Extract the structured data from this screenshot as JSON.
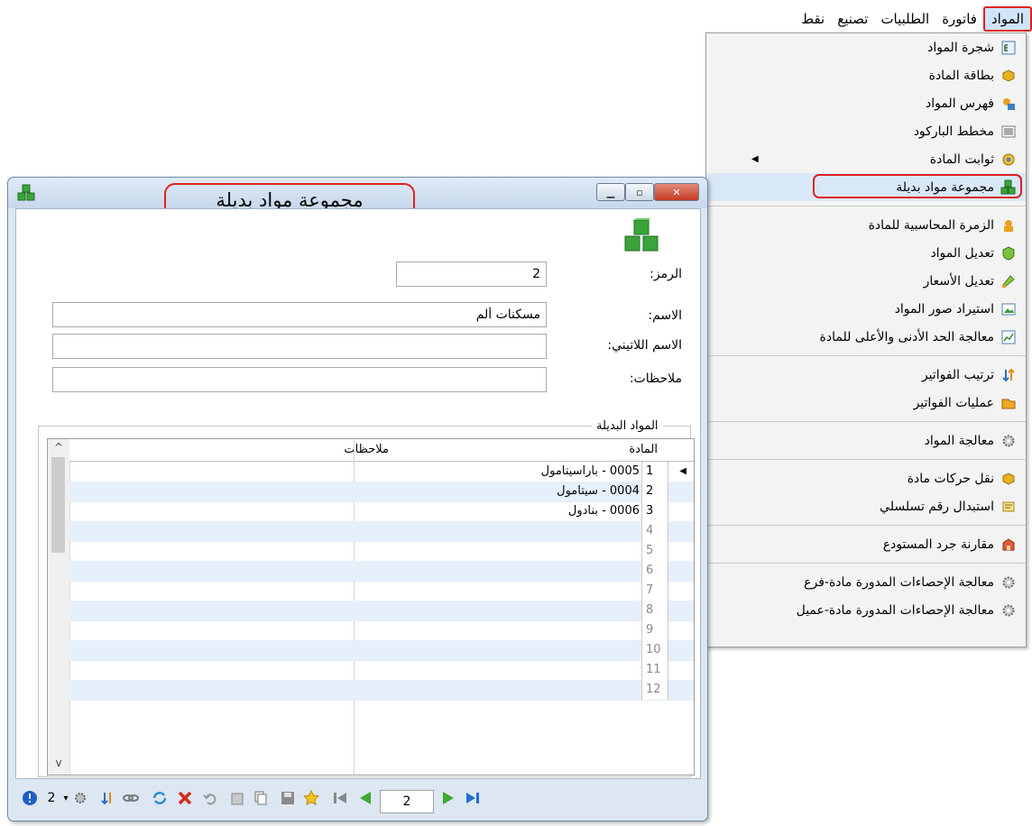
{
  "menubar": {
    "items": [
      {
        "label": "المواد",
        "active": true
      },
      {
        "label": "فاتورة",
        "active": false
      },
      {
        "label": "الطلبيات",
        "active": false
      },
      {
        "label": "تصنيع",
        "active": false
      },
      {
        "label": "نقط",
        "active": false
      }
    ]
  },
  "menu": {
    "items": [
      {
        "label": "شجرة المواد",
        "icon": "tree-icon"
      },
      {
        "label": "بطاقة المادة",
        "icon": "card-icon"
      },
      {
        "label": "فهرس المواد",
        "icon": "index-icon"
      },
      {
        "label": "مخطط الباركود",
        "icon": "barcode-icon"
      },
      {
        "label": "ثوابت المادة",
        "icon": "constants-icon"
      },
      {
        "label": "مجموعة مواد بديلة",
        "icon": "group-icon"
      },
      {
        "label": "الزمرة المحاسبية للمادة",
        "icon": "accounting-icon"
      },
      {
        "label": "تعديل المواد",
        "icon": "edit-materials-icon"
      },
      {
        "label": "تعديل الأسعار",
        "icon": "prices-icon"
      },
      {
        "label": "استيراد صور المواد",
        "icon": "import-images-icon"
      },
      {
        "label": "معالجة الحد الأدنى والأعلى للمادة",
        "icon": "minmax-icon"
      },
      {
        "label": "ترتيب الفواتير",
        "icon": "sort-icon"
      },
      {
        "label": "عمليات الفواتير",
        "icon": "operations-icon"
      },
      {
        "label": "معالجة المواد",
        "icon": "gear-icon"
      },
      {
        "label": "نقل حركات مادة",
        "icon": "transfer-icon"
      },
      {
        "label": "استبدال رقم تسلسلي",
        "icon": "serial-icon"
      },
      {
        "label": "مقارنة جرد المستودع",
        "icon": "warehouse-icon"
      },
      {
        "label": "معالجة الإحصاءات المدورة مادة-فرع",
        "icon": "gear-icon"
      },
      {
        "label": "معالجة الإحصاءات المدورة مادة-عميل",
        "icon": "gear-icon"
      }
    ]
  },
  "window": {
    "title": "مجموعة مواد بديلة",
    "code_label": "الرمز:",
    "code_value": "2",
    "name_label": "الاسم:",
    "name_value": "مسكنات ألم",
    "latin_label": "الاسم اللاتيني:",
    "latin_value": "",
    "notes_label": "ملاحظات:",
    "notes_value": "",
    "group_label": "المواد البديلة",
    "columns": {
      "material": "المادة",
      "notes": "ملاحظات"
    },
    "rows": [
      {
        "num": "1",
        "material": "0005 - باراسيتامول"
      },
      {
        "num": "2",
        "material": "0004 - سيتامول"
      },
      {
        "num": "3",
        "material": "0006 - بنادول"
      },
      {
        "num": "4",
        "material": ""
      },
      {
        "num": "5",
        "material": ""
      },
      {
        "num": "6",
        "material": ""
      },
      {
        "num": "7",
        "material": ""
      },
      {
        "num": "8",
        "material": ""
      },
      {
        "num": "9",
        "material": ""
      },
      {
        "num": "10",
        "material": ""
      },
      {
        "num": "11",
        "material": ""
      },
      {
        "num": "12",
        "material": ""
      }
    ],
    "toolbar": {
      "count": "2",
      "page": "2"
    }
  },
  "colors": {
    "accent_red": "#e02020",
    "menu_highlight": "#d9e8f8",
    "row_alt": "#e6f0fb"
  }
}
